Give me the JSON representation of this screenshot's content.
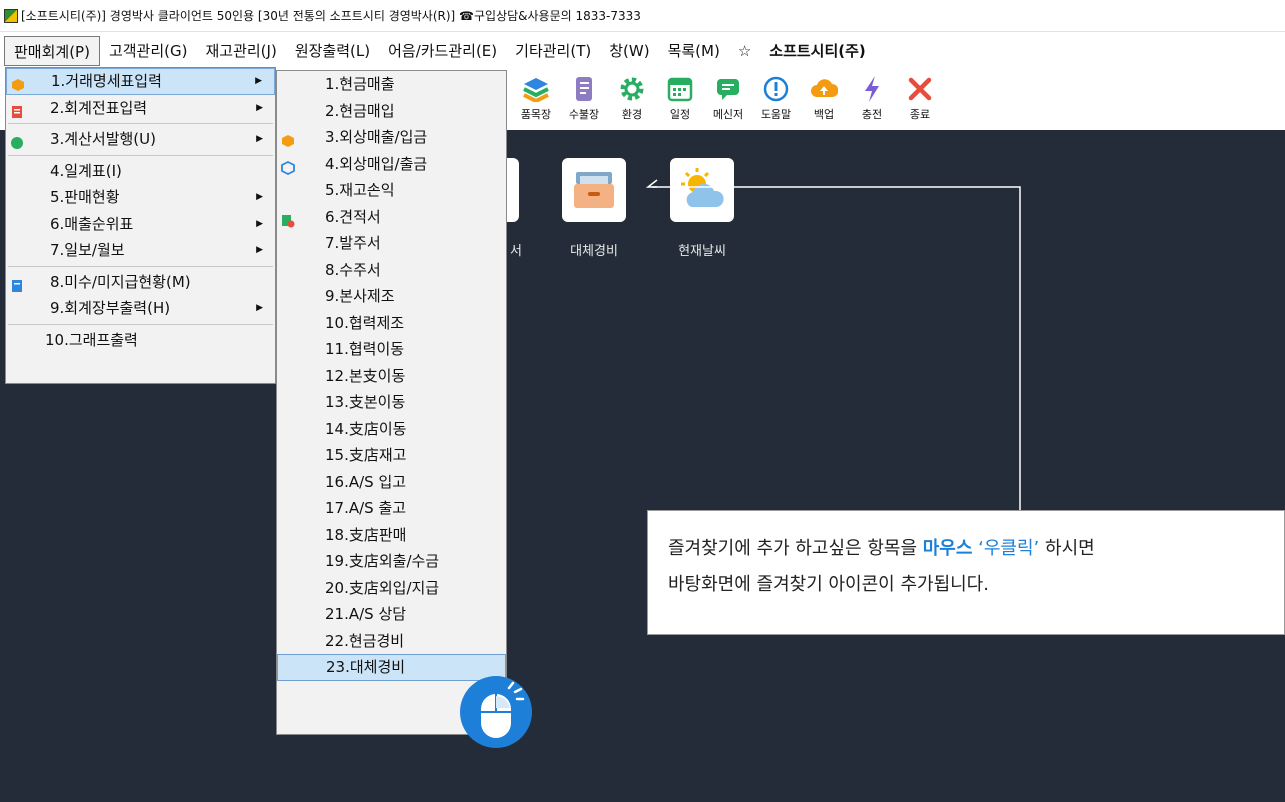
{
  "window": {
    "title": "[소프트시티(주)] 경영박사 클라이언트 50인용 [30년 전통의 소프트시티 경영박사(R)] ☎구입상담&사용문의 1833-7333"
  },
  "menubar": {
    "items": [
      "판매회계(P)",
      "고객관리(G)",
      "재고관리(J)",
      "원장출력(L)",
      "어음/카드관리(E)",
      "기타관리(T)",
      "창(W)",
      "목록(M)",
      "☆",
      "소프트시티(주)"
    ]
  },
  "toolbar": {
    "buttons": [
      {
        "label": "품목장",
        "icon": "stack-icon"
      },
      {
        "label": "수불장",
        "icon": "scroll-icon"
      },
      {
        "label": "환경",
        "icon": "gear-icon"
      },
      {
        "label": "일정",
        "icon": "calendar-icon"
      },
      {
        "label": "메신저",
        "icon": "chat-icon"
      },
      {
        "label": "도움말",
        "icon": "info-icon"
      },
      {
        "label": "백업",
        "icon": "cloud-upload-icon"
      },
      {
        "label": "충전",
        "icon": "lightning-icon"
      },
      {
        "label": "종료",
        "icon": "close-icon"
      }
    ]
  },
  "desktop": {
    "icons": [
      {
        "label": "대체경비",
        "icon": "drawer-icon"
      },
      {
        "label": "현재날씨",
        "icon": "weather-icon"
      }
    ],
    "partial_label": "서"
  },
  "main_menu": {
    "items": [
      {
        "label": "1.거래명세표입력",
        "submenu": true,
        "highlighted": true
      },
      {
        "label": "2.회계전표입력",
        "submenu": true
      },
      {
        "label": "3.계산서발행(U)",
        "submenu": true
      },
      {
        "label": "4.일계표(I)",
        "submenu": false
      },
      {
        "label": "5.판매현황",
        "submenu": true
      },
      {
        "label": "6.매출순위표",
        "submenu": true
      },
      {
        "label": "7.일보/월보",
        "submenu": true
      },
      {
        "label": "8.미수/미지급현황(M)",
        "submenu": false
      },
      {
        "label": "9.회계장부출력(H)",
        "submenu": true
      },
      {
        "label": "10.그래프출력",
        "submenu": false
      }
    ]
  },
  "sub_menu": {
    "items": [
      "1.현금매출",
      "2.현금매입",
      "3.외상매출/입금",
      "4.외상매입/출금",
      "5.재고손익",
      "6.견적서",
      "7.발주서",
      "8.수주서",
      "9.본사제조",
      "10.협력제조",
      "11.협력이동",
      "12.본支이동",
      "13.支본이동",
      "14.支店이동",
      "15.支店재고",
      "16.A/S 입고",
      "17.A/S 출고",
      "18.支店판매",
      "19.支店외출/수금",
      "20.支店외입/지급",
      "21.A/S 상담",
      "22.현금경비",
      "23.대체경비"
    ],
    "highlighted_index": 22
  },
  "callout": {
    "line1_prefix": "즐겨찾기에 추가 하고싶은 항목을 ",
    "line1_em": "마우스",
    "line1_em2": " ‘우클릭’",
    "line1_suffix": " 하시면",
    "line2": "바탕화면에 즐겨찾기 아이콘이 추가됩니다."
  },
  "colors": {
    "desktop_bg": "#232c38",
    "highlight": "#cce4f7",
    "accent_blue": "#1e7fd8"
  }
}
